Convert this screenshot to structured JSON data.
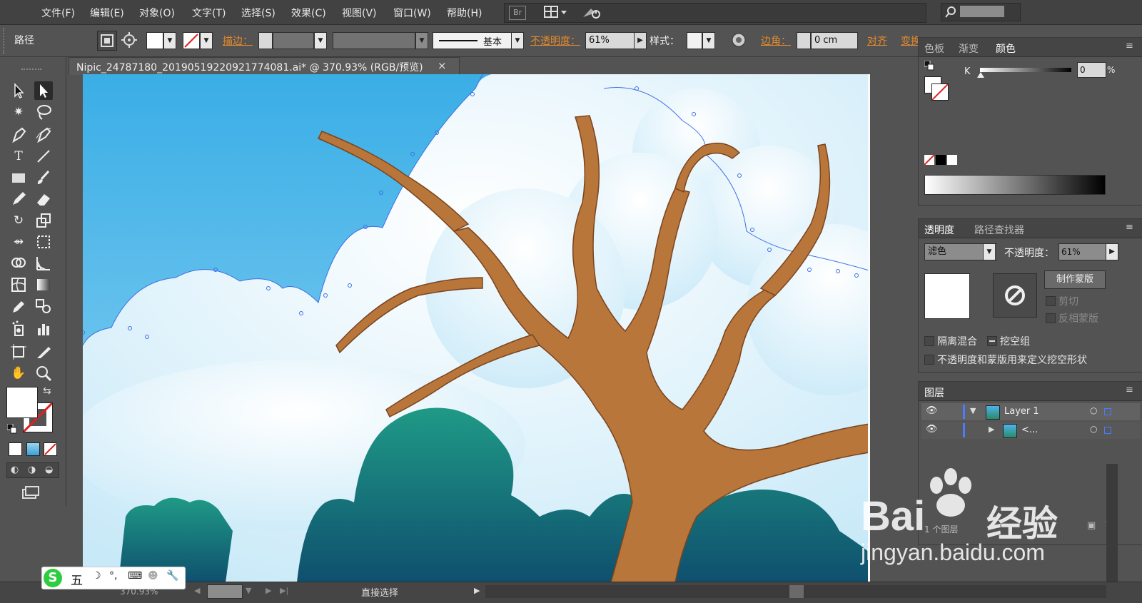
{
  "menu": [
    "文件(F)",
    "编辑(E)",
    "对象(O)",
    "文字(T)",
    "选择(S)",
    "效果(C)",
    "视图(V)",
    "窗口(W)",
    "帮助(H)"
  ],
  "bridge_label": "Br",
  "control": {
    "selection_type": "路径",
    "stroke_label": "描边：",
    "stroke_profile": "基本",
    "opacity_label": "不透明度：",
    "opacity_value": "61%",
    "style_label": "样式：",
    "corner_label": "边角：",
    "corner_value": "0 cm",
    "align_label": "对齐",
    "transform_label": "变换"
  },
  "document_tab": {
    "title": "Nipic_24787180_20190519220921774081.ai* @ 370.93% (RGB/预览)",
    "close": "×"
  },
  "color_panel": {
    "tabs": [
      "色板",
      "渐变",
      "颜色"
    ],
    "active_tab": "颜色",
    "channel_label": "K",
    "channel_value": "0",
    "unit": "%"
  },
  "transparency_panel": {
    "tabs": [
      "透明度",
      "路径查找器"
    ],
    "active_tab": "透明度",
    "blend_mode": "滤色",
    "opacity_label": "不透明度：",
    "opacity_value": "61%",
    "make_mask": "制作蒙版",
    "clip": "剪切",
    "invert_mask": "反相蒙版",
    "isolate_blending": "隔离混合",
    "knockout_group": "挖空组",
    "opacity_mask_knockout": "不透明度和蒙版用来定义挖空形状"
  },
  "layers_panel": {
    "tab": "图层",
    "rows": [
      {
        "name": "Layer 1",
        "expanded": true
      },
      {
        "name": "<...",
        "expanded": false
      }
    ],
    "footer_count": "1 个图层"
  },
  "status": {
    "zoom": "370.93%",
    "tool": "直接选择"
  },
  "ime": {
    "label": "五"
  },
  "watermark": {
    "brand": "Bai",
    "brand2": "经验",
    "url": "jingyan.baidu.com"
  },
  "colors": {
    "ui_bg": "#535353",
    "menu_bg": "#424242",
    "accent_orange": "#e58a2b",
    "sky": "#3aaee6",
    "tree_brown": "#b8763a",
    "foliage": "#1e8a7a"
  }
}
